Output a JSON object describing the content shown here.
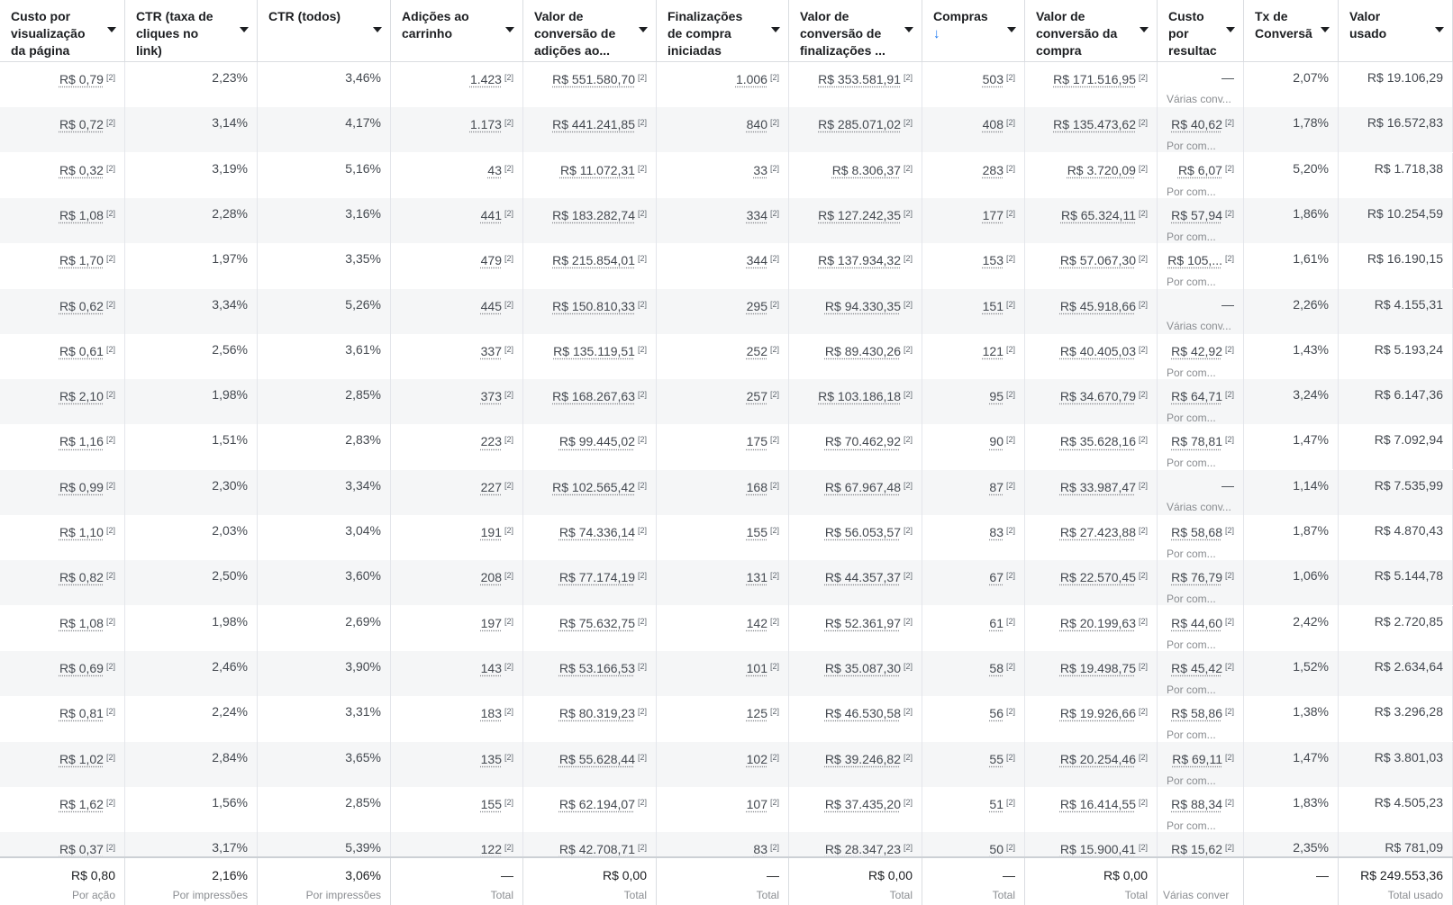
{
  "columns": [
    {
      "label": "Custo por\nvisualização\nda página de...",
      "sorted": false
    },
    {
      "label": "CTR (taxa de\ncliques no\nlink)",
      "sorted": false
    },
    {
      "label": "CTR (todos)",
      "sorted": false
    },
    {
      "label": "Adições ao\ncarrinho",
      "sorted": false
    },
    {
      "label": "Valor de\nconversão de\nadições ao...",
      "sorted": false
    },
    {
      "label": "Finalizações\nde compra\niniciadas",
      "sorted": false
    },
    {
      "label": "Valor de\nconversão de\nfinalizações ...",
      "sorted": false
    },
    {
      "label": "Compras",
      "sorted": true,
      "sort_arrow": "↓"
    },
    {
      "label": "Valor de\nconversão da\ncompra",
      "sorted": false
    },
    {
      "label": "Custo\npor\nresultac",
      "sorted": false
    },
    {
      "label": "Tx de\nConversã",
      "sorted": false
    },
    {
      "label": "Valor\nusado",
      "sorted": false
    }
  ],
  "attribution_mark": "[2]",
  "rows": [
    {
      "cpv": "R$ 0,79",
      "ctr_link": "2,23%",
      "ctr_all": "3,46%",
      "add_cart": "1.423",
      "add_cart_value": "R$ 551.580,70",
      "checkouts": "1.006",
      "checkout_value": "R$ 353.581,91",
      "purchases": "503",
      "purchase_value": "R$ 171.516,95",
      "cost_result": "—",
      "cost_result_sub": "Várias conv...",
      "conv_rate": "2,07%",
      "spent": "R$ 19.106,29"
    },
    {
      "cpv": "R$ 0,72",
      "ctr_link": "3,14%",
      "ctr_all": "4,17%",
      "add_cart": "1.173",
      "add_cart_value": "R$ 441.241,85",
      "checkouts": "840",
      "checkout_value": "R$ 285.071,02",
      "purchases": "408",
      "purchase_value": "R$ 135.473,62",
      "cost_result": "R$ 40,62",
      "cost_result_sub": "Por com...",
      "conv_rate": "1,78%",
      "spent": "R$ 16.572,83"
    },
    {
      "cpv": "R$ 0,32",
      "ctr_link": "3,19%",
      "ctr_all": "5,16%",
      "add_cart": "43",
      "add_cart_value": "R$ 11.072,31",
      "checkouts": "33",
      "checkout_value": "R$ 8.306,37",
      "purchases": "283",
      "purchase_value": "R$ 3.720,09",
      "cost_result": "R$ 6,07",
      "cost_result_sub": "Por com...",
      "conv_rate": "5,20%",
      "spent": "R$ 1.718,38"
    },
    {
      "cpv": "R$ 1,08",
      "ctr_link": "2,28%",
      "ctr_all": "3,16%",
      "add_cart": "441",
      "add_cart_value": "R$ 183.282,74",
      "checkouts": "334",
      "checkout_value": "R$ 127.242,35",
      "purchases": "177",
      "purchase_value": "R$ 65.324,11",
      "cost_result": "R$ 57,94",
      "cost_result_sub": "Por com...",
      "conv_rate": "1,86%",
      "spent": "R$ 10.254,59"
    },
    {
      "cpv": "R$ 1,70",
      "ctr_link": "1,97%",
      "ctr_all": "3,35%",
      "add_cart": "479",
      "add_cart_value": "R$ 215.854,01",
      "checkouts": "344",
      "checkout_value": "R$ 137.934,32",
      "purchases": "153",
      "purchase_value": "R$ 57.067,30",
      "cost_result": "R$ 105,...",
      "cost_result_sub": "Por com...",
      "conv_rate": "1,61%",
      "spent": "R$ 16.190,15"
    },
    {
      "cpv": "R$ 0,62",
      "ctr_link": "3,34%",
      "ctr_all": "5,26%",
      "add_cart": "445",
      "add_cart_value": "R$ 150.810,33",
      "checkouts": "295",
      "checkout_value": "R$ 94.330,35",
      "purchases": "151",
      "purchase_value": "R$ 45.918,66",
      "cost_result": "—",
      "cost_result_sub": "Várias conv...",
      "conv_rate": "2,26%",
      "spent": "R$ 4.155,31"
    },
    {
      "cpv": "R$ 0,61",
      "ctr_link": "2,56%",
      "ctr_all": "3,61%",
      "add_cart": "337",
      "add_cart_value": "R$ 135.119,51",
      "checkouts": "252",
      "checkout_value": "R$ 89.430,26",
      "purchases": "121",
      "purchase_value": "R$ 40.405,03",
      "cost_result": "R$ 42,92",
      "cost_result_sub": "Por com...",
      "conv_rate": "1,43%",
      "spent": "R$ 5.193,24"
    },
    {
      "cpv": "R$ 2,10",
      "ctr_link": "1,98%",
      "ctr_all": "2,85%",
      "add_cart": "373",
      "add_cart_value": "R$ 168.267,63",
      "checkouts": "257",
      "checkout_value": "R$ 103.186,18",
      "purchases": "95",
      "purchase_value": "R$ 34.670,79",
      "cost_result": "R$ 64,71",
      "cost_result_sub": "Por com...",
      "conv_rate": "3,24%",
      "spent": "R$ 6.147,36"
    },
    {
      "cpv": "R$ 1,16",
      "ctr_link": "1,51%",
      "ctr_all": "2,83%",
      "add_cart": "223",
      "add_cart_value": "R$ 99.445,02",
      "checkouts": "175",
      "checkout_value": "R$ 70.462,92",
      "purchases": "90",
      "purchase_value": "R$ 35.628,16",
      "cost_result": "R$ 78,81",
      "cost_result_sub": "Por com...",
      "conv_rate": "1,47%",
      "spent": "R$ 7.092,94"
    },
    {
      "cpv": "R$ 0,99",
      "ctr_link": "2,30%",
      "ctr_all": "3,34%",
      "add_cart": "227",
      "add_cart_value": "R$ 102.565,42",
      "checkouts": "168",
      "checkout_value": "R$ 67.967,48",
      "purchases": "87",
      "purchase_value": "R$ 33.987,47",
      "cost_result": "—",
      "cost_result_sub": "Várias conv...",
      "conv_rate": "1,14%",
      "spent": "R$ 7.535,99"
    },
    {
      "cpv": "R$ 1,10",
      "ctr_link": "2,03%",
      "ctr_all": "3,04%",
      "add_cart": "191",
      "add_cart_value": "R$ 74.336,14",
      "checkouts": "155",
      "checkout_value": "R$ 56.053,57",
      "purchases": "83",
      "purchase_value": "R$ 27.423,88",
      "cost_result": "R$ 58,68",
      "cost_result_sub": "Por com...",
      "conv_rate": "1,87%",
      "spent": "R$ 4.870,43"
    },
    {
      "cpv": "R$ 0,82",
      "ctr_link": "2,50%",
      "ctr_all": "3,60%",
      "add_cart": "208",
      "add_cart_value": "R$ 77.174,19",
      "checkouts": "131",
      "checkout_value": "R$ 44.357,37",
      "purchases": "67",
      "purchase_value": "R$ 22.570,45",
      "cost_result": "R$ 76,79",
      "cost_result_sub": "Por com...",
      "conv_rate": "1,06%",
      "spent": "R$ 5.144,78"
    },
    {
      "cpv": "R$ 1,08",
      "ctr_link": "1,98%",
      "ctr_all": "2,69%",
      "add_cart": "197",
      "add_cart_value": "R$ 75.632,75",
      "checkouts": "142",
      "checkout_value": "R$ 52.361,97",
      "purchases": "61",
      "purchase_value": "R$ 20.199,63",
      "cost_result": "R$ 44,60",
      "cost_result_sub": "Por com...",
      "conv_rate": "2,42%",
      "spent": "R$ 2.720,85"
    },
    {
      "cpv": "R$ 0,69",
      "ctr_link": "2,46%",
      "ctr_all": "3,90%",
      "add_cart": "143",
      "add_cart_value": "R$ 53.166,53",
      "checkouts": "101",
      "checkout_value": "R$ 35.087,30",
      "purchases": "58",
      "purchase_value": "R$ 19.498,75",
      "cost_result": "R$ 45,42",
      "cost_result_sub": "Por com...",
      "conv_rate": "1,52%",
      "spent": "R$ 2.634,64"
    },
    {
      "cpv": "R$ 0,81",
      "ctr_link": "2,24%",
      "ctr_all": "3,31%",
      "add_cart": "183",
      "add_cart_value": "R$ 80.319,23",
      "checkouts": "125",
      "checkout_value": "R$ 46.530,58",
      "purchases": "56",
      "purchase_value": "R$ 19.926,66",
      "cost_result": "R$ 58,86",
      "cost_result_sub": "Por com...",
      "conv_rate": "1,38%",
      "spent": "R$ 3.296,28"
    },
    {
      "cpv": "R$ 1,02",
      "ctr_link": "2,84%",
      "ctr_all": "3,65%",
      "add_cart": "135",
      "add_cart_value": "R$ 55.628,44",
      "checkouts": "102",
      "checkout_value": "R$ 39.246,82",
      "purchases": "55",
      "purchase_value": "R$ 20.254,46",
      "cost_result": "R$ 69,11",
      "cost_result_sub": "Por com...",
      "conv_rate": "1,47%",
      "spent": "R$ 3.801,03"
    },
    {
      "cpv": "R$ 1,62",
      "ctr_link": "1,56%",
      "ctr_all": "2,85%",
      "add_cart": "155",
      "add_cart_value": "R$ 62.194,07",
      "checkouts": "107",
      "checkout_value": "R$ 37.435,20",
      "purchases": "51",
      "purchase_value": "R$ 16.414,55",
      "cost_result": "R$ 88,34",
      "cost_result_sub": "Por com...",
      "conv_rate": "1,83%",
      "spent": "R$ 4.505,23"
    },
    {
      "cpv": "R$ 0,37",
      "ctr_link": "3,17%",
      "ctr_all": "5,39%",
      "add_cart": "122",
      "add_cart_value": "R$ 42.708,71",
      "checkouts": "83",
      "checkout_value": "R$ 28.347,23",
      "purchases": "50",
      "purchase_value": "R$ 15.900,41",
      "cost_result": "R$ 15,62",
      "cost_result_sub": "",
      "conv_rate": "2,35%",
      "spent": "R$ 781,09"
    }
  ],
  "totals": [
    {
      "value": "R$ 0,80",
      "label": "Por ação"
    },
    {
      "value": "2,16%",
      "label": "Por impressões"
    },
    {
      "value": "3,06%",
      "label": "Por impressões"
    },
    {
      "value": "—",
      "label": "Total"
    },
    {
      "value": "R$ 0,00",
      "label": "Total"
    },
    {
      "value": "—",
      "label": "Total"
    },
    {
      "value": "R$ 0,00",
      "label": "Total"
    },
    {
      "value": "—",
      "label": "Total"
    },
    {
      "value": "R$ 0,00",
      "label": "Total"
    },
    {
      "value": "",
      "label": "Várias conver"
    },
    {
      "value": "—",
      "label": ""
    },
    {
      "value": "R$ 249.553,36",
      "label": "Total usado"
    }
  ],
  "colors": {
    "sort_arrow": "#1877f2",
    "row_alt": "#f5f6f7",
    "grid": "#e4e6eb"
  }
}
